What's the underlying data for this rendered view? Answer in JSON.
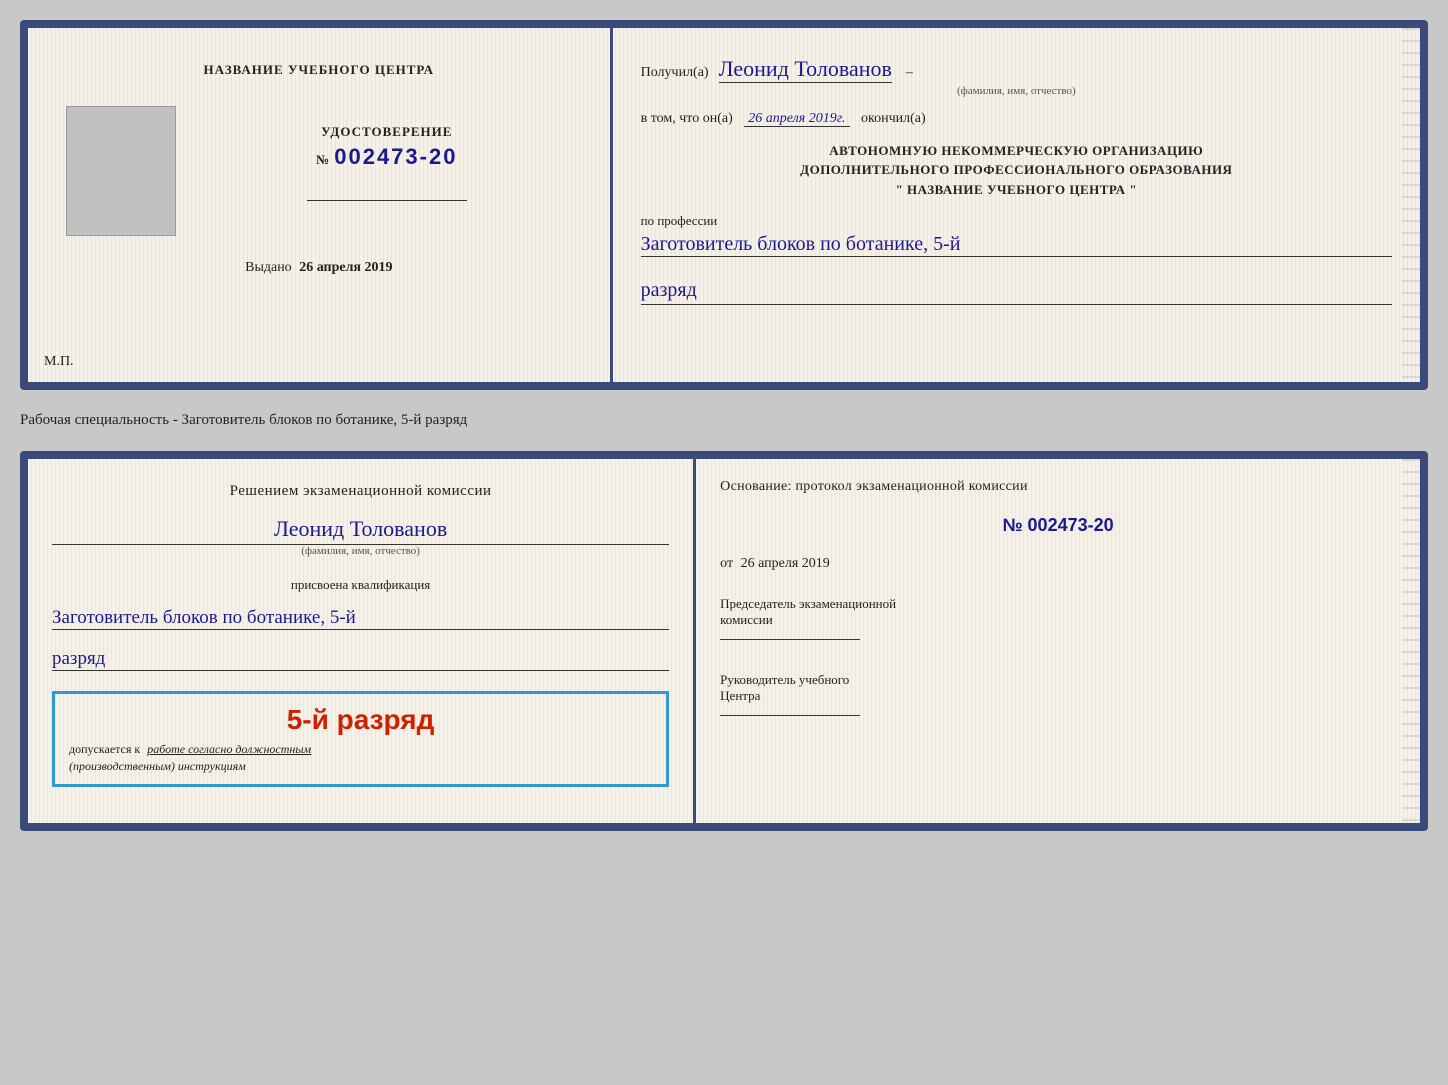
{
  "doc1": {
    "left": {
      "heading": "НАЗВАНИЕ УЧЕБНОГО ЦЕНТРА",
      "cert_label": "УДОСТОВЕРЕНИЕ",
      "cert_number_prefix": "№",
      "cert_number": "002473-20",
      "issued_label": "Выдано",
      "issued_date": "26 апреля 2019",
      "mp_label": "М.П."
    },
    "right": {
      "poluchil_prefix": "Получил(а)",
      "recipient_name": "Леонид Толованов",
      "fio_subtitle": "(фамилия, имя, отчество)",
      "vtom_prefix": "в том, что он(а)",
      "vtom_date": "26 апреля 2019г.",
      "okonchil": "окончил(а)",
      "org_line1": "АВТОНОМНУЮ НЕКОММЕРЧЕСКУЮ ОРГАНИЗАЦИЮ",
      "org_line2": "ДОПОЛНИТЕЛЬНОГО ПРОФЕССИОНАЛЬНОГО ОБРАЗОВАНИЯ",
      "org_name": "\" НАЗВАНИЕ УЧЕБНОГО ЦЕНТРА \"",
      "po_professii": "по профессии",
      "profession": "Заготовитель блоков по ботанике, 5-й",
      "razryad": "разряд"
    }
  },
  "specialty_label": "Рабочая специальность - Заготовитель блоков по ботанике, 5-й разряд",
  "doc2": {
    "left": {
      "komissia_heading": "Решением экзаменационной комиссии",
      "komissia_name": "Леонид Толованов",
      "fio_subtitle": "(фамилия, имя, отчество)",
      "prisvoena": "присвоена квалификация",
      "kvalif": "Заготовитель блоков по ботанике, 5-й",
      "razryad": "разряд",
      "stamp_big": "5-й разряд",
      "stamp_dopusk": "допускается к",
      "stamp_rabote": "работе согласно должностным",
      "stamp_instruk": "(производственным) инструкциям"
    },
    "right": {
      "osnov_heading": "Основание: протокол экзаменационной комиссии",
      "prot_number": "№  002473-20",
      "ot_label": "от",
      "ot_date": "26 апреля 2019",
      "predsedatel_label": "Председатель экзаменационной",
      "predsedatel_label2": "комиссии",
      "rukiv_label": "Руководитель учебного",
      "rukiv_label2": "Центра"
    }
  }
}
